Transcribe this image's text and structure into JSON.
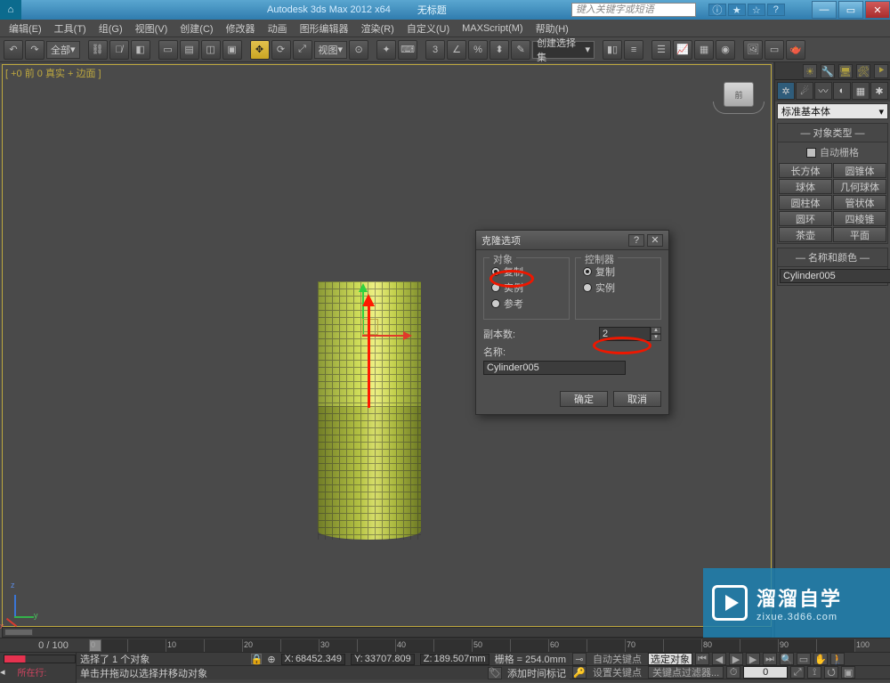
{
  "titlebar": {
    "app": "Autodesk 3ds Max 2012 x64",
    "doc": "无标题",
    "search_ph": "键入关键字或短语"
  },
  "menu": [
    "编辑(E)",
    "工具(T)",
    "组(G)",
    "视图(V)",
    "创建(C)",
    "修改器",
    "动画",
    "图形编辑器",
    "渲染(R)",
    "自定义(U)",
    "MAXScript(M)",
    "帮助(H)"
  ],
  "toolbar": {
    "filter": "全部",
    "viewsel": "视图",
    "cmdset": "创建选择集"
  },
  "vp_label": "[ +0 前 0 真实 + 边面 ]",
  "panel": {
    "dropdown": "标准基本体",
    "rollout1": "对象类型",
    "autogrid": "自动栅格",
    "buttons": [
      [
        "长方体",
        "圆锥体"
      ],
      [
        "球体",
        "几何球体"
      ],
      [
        "圆柱体",
        "管状体"
      ],
      [
        "圆环",
        "四棱锥"
      ],
      [
        "茶壶",
        "平面"
      ]
    ],
    "rollout2": "名称和颜色",
    "objname": "Cylinder005"
  },
  "dialog": {
    "title": "克隆选项",
    "g_obj": "对象",
    "g_ctrl": "控制器",
    "r_copy": "复制",
    "r_inst": "实例",
    "r_ref": "参考",
    "copies_lbl": "副本数:",
    "copies_val": "2",
    "name_lbl": "名称:",
    "name_val": "Cylinder005",
    "ok": "确定",
    "cancel": "取消"
  },
  "timeline": {
    "pos": "0 / 100"
  },
  "status": {
    "sel": "选择了 1 个对象",
    "prompt": "单击并拖动以选择并移动对象",
    "x": "68452.349",
    "y": "33707.809",
    "z": "189.507mm",
    "grid": "栅格 = 254.0mm",
    "addtag": "添加时间标记",
    "here": "所在行:",
    "autokey": "自动关键点",
    "selset": "选定对象",
    "setkey": "设置关键点",
    "keyfilt": "关键点过滤器..."
  },
  "watermark": {
    "t1": "溜溜自学",
    "t2": "zixue.3d66.com"
  }
}
